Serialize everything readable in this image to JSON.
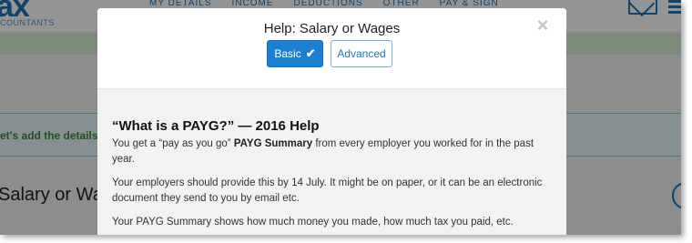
{
  "background": {
    "logo_text": "ax",
    "logo_sub": "COUNTANTS",
    "nav": [
      "MY DETAILS",
      "INCOME",
      "DEDUCTIONS",
      "OTHER",
      "PAY & SIGN"
    ],
    "banner_text": "et's add the details",
    "section_title": "Salary or Wa"
  },
  "modal": {
    "title": "Help: Salary or Wages",
    "close_glyph": "×",
    "basic_label": "Basic",
    "basic_check": "✔",
    "advanced_label": "Advanced",
    "help_title": "“What is a PAYG?” — 2016 Help",
    "p1_before": "You get a “pay as you go” ",
    "p1_bold": "PAYG Summary",
    "p1_after": " from every employer you worked for in the past year.",
    "p2": "Your employers should provide this by 14 July. It might be on paper, or it can be an electronic document they send to you by email etc.",
    "p3": "Your PAYG Summary shows how much money you made, how much tax you paid, etc."
  },
  "colors": {
    "accent": "#1d7fcf",
    "link_blue": "#1e74b8",
    "body_bg": "#f2f2f2"
  }
}
